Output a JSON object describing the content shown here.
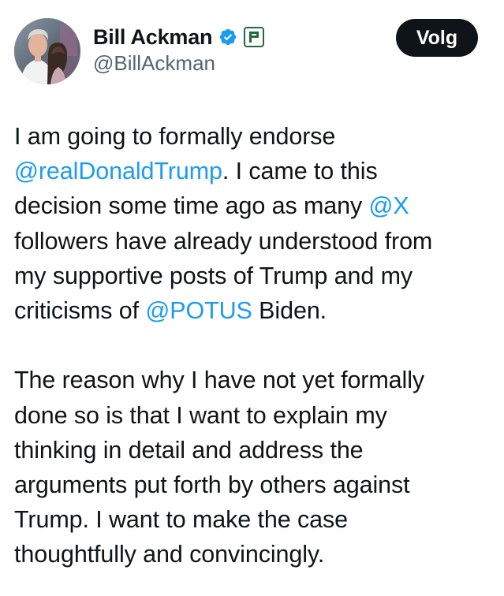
{
  "colors": {
    "text": "#0f1419",
    "secondary_text": "#536471",
    "link": "#1d9bf0",
    "follow_button_bg": "#0f1419",
    "follow_button_text": "#ffffff",
    "verified_badge": "#1d9bf0",
    "affiliate_badge": "#1f6b3a"
  },
  "author": {
    "display_name": "Bill Ackman",
    "handle": "@BillAckman",
    "verified_icon": "verified-badge-icon",
    "affiliate_icon": "pershing-square-affiliate-icon"
  },
  "actions": {
    "follow_label": "Volg"
  },
  "post": {
    "paragraph1": {
      "line1": "I am going to formally endorse",
      "line2_mention": "@realDonaldTrump",
      "line2_text": ". I came to this",
      "line3_text": "decision some time ago as many ",
      "line3_mention": "@X",
      "line4": "followers have already understood from",
      "line5": "my supportive posts of Trump and my",
      "line6_text": "criticisms of ",
      "line6_mention": "@POTUS",
      "line6_end": " Biden."
    },
    "paragraph2": {
      "line1": "The reason why I have not yet formally",
      "line2": "done so is that I want to explain my",
      "line3": "thinking in detail and address the",
      "line4": "arguments put forth by others against",
      "line5": "Trump. I want to make the case",
      "line6": "thoughtfully and convincingly."
    }
  }
}
